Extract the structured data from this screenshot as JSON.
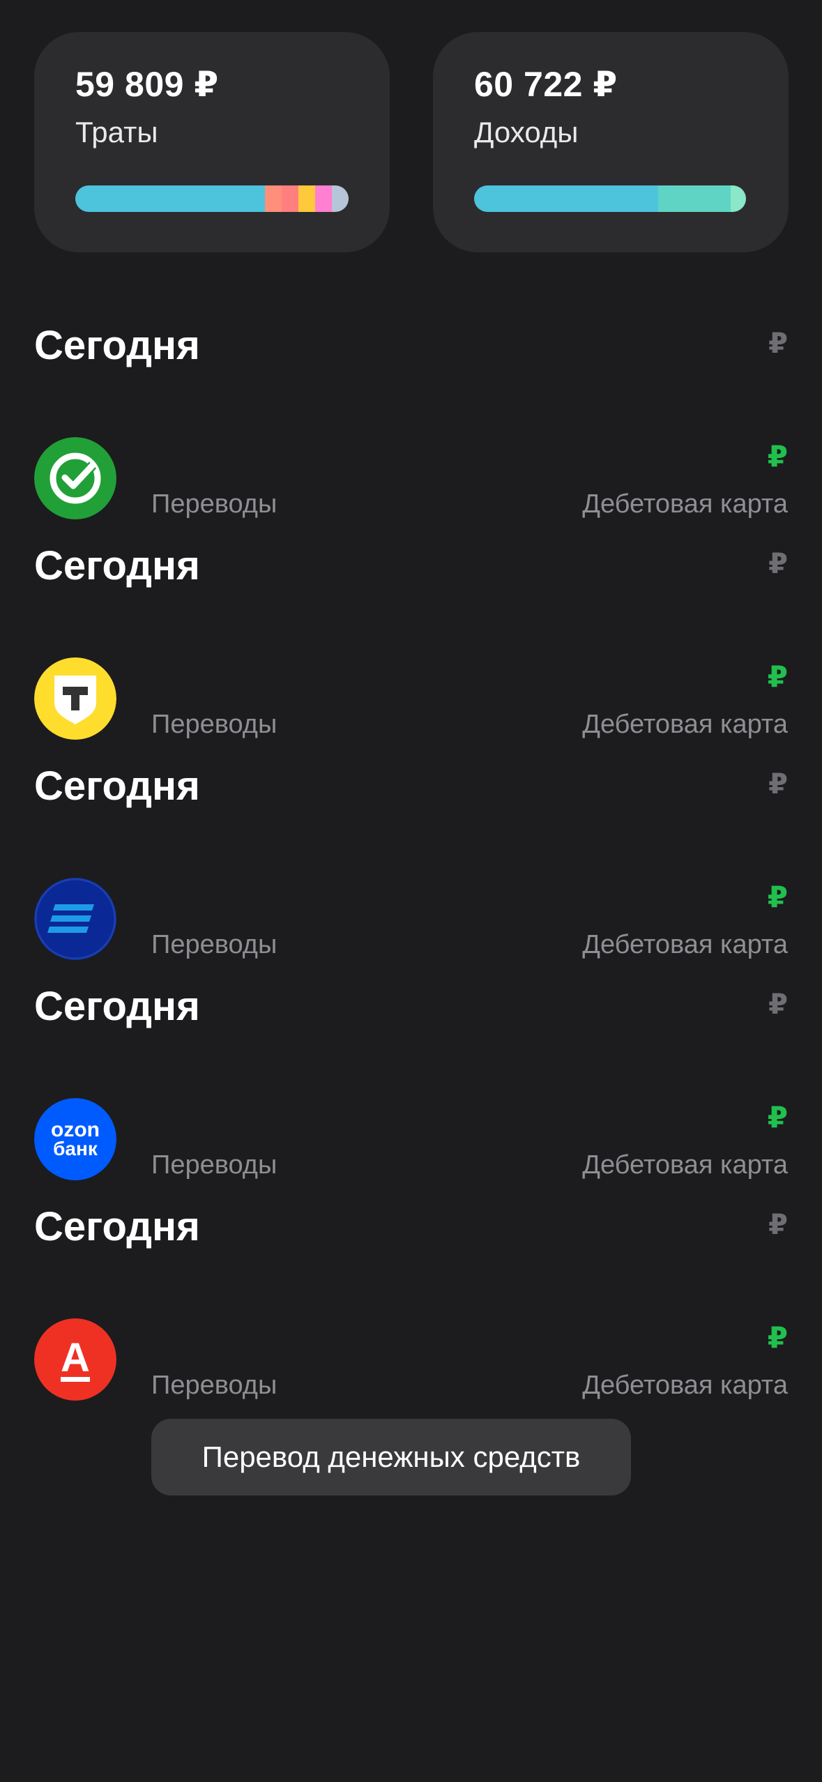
{
  "summary": {
    "expenses": {
      "amount": "59 809 ₽",
      "label": "Траты"
    },
    "income": {
      "amount": "60 722 ₽",
      "label": "Доходы"
    }
  },
  "colors": {
    "background": "#1c1c1e",
    "card": "#2c2c2e",
    "accent_green": "#21c04e",
    "secondary_text": "#8e8e93"
  },
  "transactions": [
    {
      "section": "Сегодня",
      "section_currency": "₽",
      "bank_icon": "sber-icon",
      "currency": "₽",
      "category": "Переводы",
      "account": "Дебетовая карта"
    },
    {
      "section": "Сегодня",
      "section_currency": "₽",
      "bank_icon": "tbank-icon",
      "currency": "₽",
      "category": "Переводы",
      "account": "Дебетовая карта"
    },
    {
      "section": "Сегодня",
      "section_currency": "₽",
      "bank_icon": "vtb-icon",
      "currency": "₽",
      "category": "Переводы",
      "account": "Дебетовая карта"
    },
    {
      "section": "Сегодня",
      "section_currency": "₽",
      "bank_icon": "ozon-bank-icon",
      "bank_text_1": "ozon",
      "bank_text_2": "банк",
      "currency": "₽",
      "category": "Переводы",
      "account": "Дебетовая карта"
    },
    {
      "section": "Сегодня",
      "section_currency": "₽",
      "bank_icon": "alfa-bank-icon",
      "bank_letter": "А",
      "currency": "₽",
      "category": "Переводы",
      "account": "Дебетовая карта"
    }
  ],
  "tooltip": "Перевод денежных средств"
}
